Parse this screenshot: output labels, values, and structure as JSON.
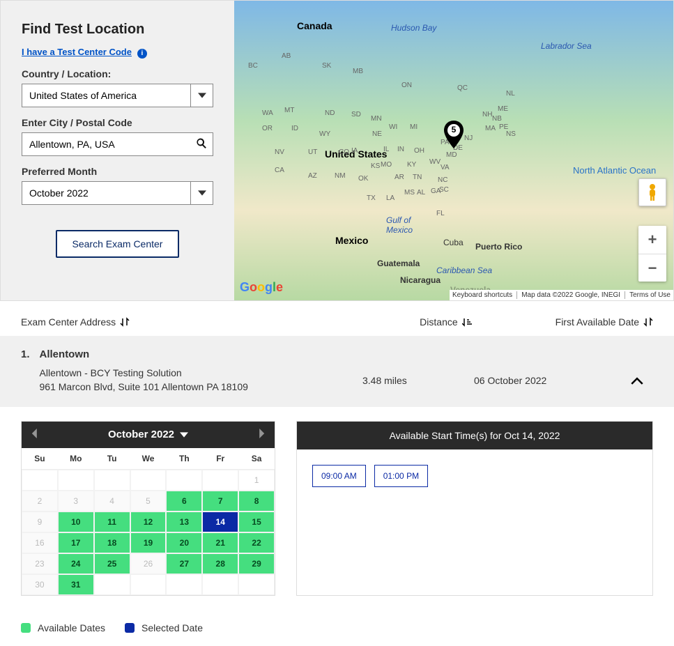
{
  "panel": {
    "heading": "Find Test Location",
    "tcc_link": "I have a Test Center Code",
    "country_label": "Country / Location:",
    "country_value": "United States of America",
    "city_label": "Enter City / Postal Code",
    "city_value": "Allentown, PA, USA",
    "month_label": "Preferred Month",
    "month_value": "October 2022",
    "search_btn": "Search Exam Center"
  },
  "map": {
    "marker_count": "5",
    "countries": {
      "canada": "Canada",
      "us": "United States",
      "mexico": "Mexico",
      "cuba": "Cuba",
      "guatemala": "Guatemala",
      "nicaragua": "Nicaragua",
      "pr": "Puerto Rico",
      "venezuela": "Venezuela"
    },
    "water": {
      "hudson": "Hudson Bay",
      "labrador": "Labrador Sea",
      "caribbean": "Caribbean Sea",
      "gulf": "Gulf of\nMexico",
      "ocean": "North\nAtlantic\nOcean"
    },
    "attribution": {
      "shortcuts": "Keyboard shortcuts",
      "data": "Map data ©2022 Google, INEGI",
      "terms": "Terms of Use"
    }
  },
  "sort": {
    "address": "Exam Center Address",
    "distance": "Distance",
    "date": "First Available Date"
  },
  "result": {
    "num": "1.",
    "name": "Allentown",
    "addr1": "Allentown - BCY Testing Solution",
    "addr2": "961 Marcon Blvd, Suite 101 Allentown PA 18109",
    "distance": "3.48 miles",
    "first_date": "06 October 2022"
  },
  "calendar": {
    "title": "October 2022",
    "dow": [
      "Su",
      "Mo",
      "Tu",
      "We",
      "Th",
      "Fr",
      "Sa"
    ],
    "weeks": [
      [
        {
          "n": "",
          "s": "empty"
        },
        {
          "n": "",
          "s": "empty"
        },
        {
          "n": "",
          "s": "empty"
        },
        {
          "n": "",
          "s": "empty"
        },
        {
          "n": "",
          "s": "empty"
        },
        {
          "n": "",
          "s": "empty"
        },
        {
          "n": "1",
          "s": "muted"
        }
      ],
      [
        {
          "n": "2",
          "s": "disabled"
        },
        {
          "n": "3",
          "s": "disabled"
        },
        {
          "n": "4",
          "s": "disabled"
        },
        {
          "n": "5",
          "s": "disabled"
        },
        {
          "n": "6",
          "s": "avail"
        },
        {
          "n": "7",
          "s": "avail"
        },
        {
          "n": "8",
          "s": "avail"
        }
      ],
      [
        {
          "n": "9",
          "s": "disabled"
        },
        {
          "n": "10",
          "s": "avail"
        },
        {
          "n": "11",
          "s": "avail"
        },
        {
          "n": "12",
          "s": "avail"
        },
        {
          "n": "13",
          "s": "avail"
        },
        {
          "n": "14",
          "s": "selected"
        },
        {
          "n": "15",
          "s": "avail"
        }
      ],
      [
        {
          "n": "16",
          "s": "disabled"
        },
        {
          "n": "17",
          "s": "avail"
        },
        {
          "n": "18",
          "s": "avail"
        },
        {
          "n": "19",
          "s": "avail"
        },
        {
          "n": "20",
          "s": "avail"
        },
        {
          "n": "21",
          "s": "avail"
        },
        {
          "n": "22",
          "s": "avail"
        }
      ],
      [
        {
          "n": "23",
          "s": "disabled"
        },
        {
          "n": "24",
          "s": "avail"
        },
        {
          "n": "25",
          "s": "avail"
        },
        {
          "n": "26",
          "s": "disabled"
        },
        {
          "n": "27",
          "s": "avail"
        },
        {
          "n": "28",
          "s": "avail"
        },
        {
          "n": "29",
          "s": "avail"
        }
      ],
      [
        {
          "n": "30",
          "s": "disabled"
        },
        {
          "n": "31",
          "s": "avail"
        },
        {
          "n": "",
          "s": "empty"
        },
        {
          "n": "",
          "s": "empty"
        },
        {
          "n": "",
          "s": "empty"
        },
        {
          "n": "",
          "s": "empty"
        },
        {
          "n": "",
          "s": "empty"
        }
      ]
    ]
  },
  "legend": {
    "avail": "Available Dates",
    "selected": "Selected Date"
  },
  "times": {
    "heading": "Available Start Time(s) for Oct 14, 2022",
    "slots": [
      "09:00 AM",
      "01:00 PM"
    ]
  }
}
